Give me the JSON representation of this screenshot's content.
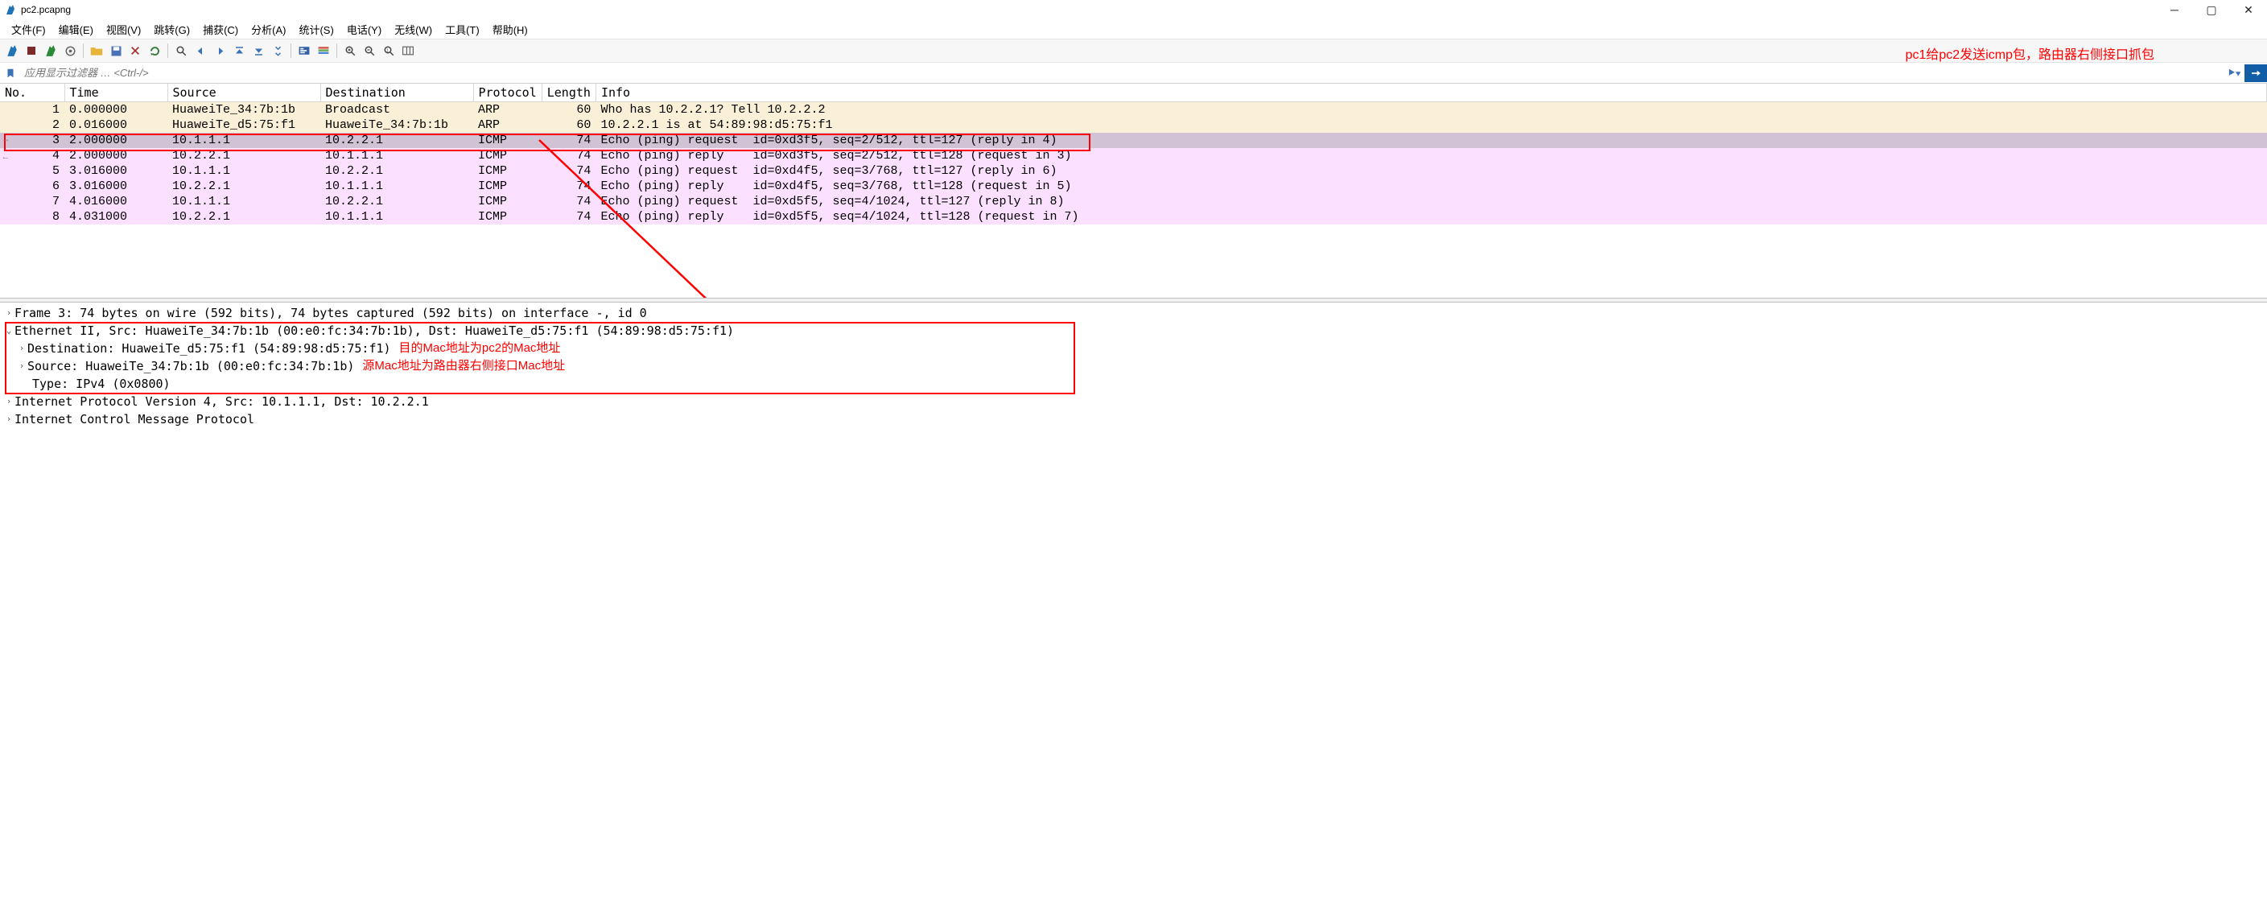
{
  "window": {
    "title": "pc2.pcapng"
  },
  "menu": {
    "items": [
      "文件(F)",
      "编辑(E)",
      "视图(V)",
      "跳转(G)",
      "捕获(C)",
      "分析(A)",
      "统计(S)",
      "电话(Y)",
      "无线(W)",
      "工具(T)",
      "帮助(H)"
    ]
  },
  "annotations": {
    "top": "pc1给pc2发送icmp包，路由器右侧接口抓包",
    "dst_mac": "目的Mac地址为pc2的Mac地址",
    "src_mac": "源Mac地址为路由器右侧接口Mac地址"
  },
  "filter": {
    "placeholder": "应用显示过滤器 … <Ctrl-/>"
  },
  "columns": {
    "no": "No.",
    "time": "Time",
    "source": "Source",
    "destination": "Destination",
    "protocol": "Protocol",
    "length": "Length",
    "info": "Info"
  },
  "packets": [
    {
      "no": "1",
      "time": "0.000000",
      "src": "HuaweiTe_34:7b:1b",
      "dst": "Broadcast",
      "proto": "ARP",
      "len": "60",
      "info": "Who has 10.2.2.1? Tell 10.2.2.2",
      "cls": "arp"
    },
    {
      "no": "2",
      "time": "0.016000",
      "src": "HuaweiTe_d5:75:f1",
      "dst": "HuaweiTe_34:7b:1b",
      "proto": "ARP",
      "len": "60",
      "info": "10.2.2.1 is at 54:89:98:d5:75:f1",
      "cls": "arp"
    },
    {
      "no": "3",
      "time": "2.000000",
      "src": "10.1.1.1",
      "dst": "10.2.2.1",
      "proto": "ICMP",
      "len": "74",
      "info": "Echo (ping) request  id=0xd3f5, seq=2/512, ttl=127 (reply in 4)",
      "cls": "icmp selected"
    },
    {
      "no": "4",
      "time": "2.000000",
      "src": "10.2.2.1",
      "dst": "10.1.1.1",
      "proto": "ICMP",
      "len": "74",
      "info": "Echo (ping) reply    id=0xd3f5, seq=2/512, ttl=128 (request in 3)",
      "cls": "icmp"
    },
    {
      "no": "5",
      "time": "3.016000",
      "src": "10.1.1.1",
      "dst": "10.2.2.1",
      "proto": "ICMP",
      "len": "74",
      "info": "Echo (ping) request  id=0xd4f5, seq=3/768, ttl=127 (reply in 6)",
      "cls": "icmp"
    },
    {
      "no": "6",
      "time": "3.016000",
      "src": "10.2.2.1",
      "dst": "10.1.1.1",
      "proto": "ICMP",
      "len": "74",
      "info": "Echo (ping) reply    id=0xd4f5, seq=3/768, ttl=128 (request in 5)",
      "cls": "icmp"
    },
    {
      "no": "7",
      "time": "4.016000",
      "src": "10.1.1.1",
      "dst": "10.2.2.1",
      "proto": "ICMP",
      "len": "74",
      "info": "Echo (ping) request  id=0xd5f5, seq=4/1024, ttl=127 (reply in 8)",
      "cls": "icmp"
    },
    {
      "no": "8",
      "time": "4.031000",
      "src": "10.2.2.1",
      "dst": "10.1.1.1",
      "proto": "ICMP",
      "len": "74",
      "info": "Echo (ping) reply    id=0xd5f5, seq=4/1024, ttl=128 (request in 7)",
      "cls": "icmp"
    }
  ],
  "details": {
    "frame": "Frame 3: 74 bytes on wire (592 bits), 74 bytes captured (592 bits) on interface -, id 0",
    "eth": "Ethernet II, Src: HuaweiTe_34:7b:1b (00:e0:fc:34:7b:1b), Dst: HuaweiTe_d5:75:f1 (54:89:98:d5:75:f1)",
    "eth_dst": "Destination: HuaweiTe_d5:75:f1 (54:89:98:d5:75:f1)",
    "eth_src": "Source: HuaweiTe_34:7b:1b (00:e0:fc:34:7b:1b)",
    "eth_type": "Type: IPv4 (0x0800)",
    "ip": "Internet Protocol Version 4, Src: 10.1.1.1, Dst: 10.2.2.1",
    "icmp": "Internet Control Message Protocol"
  }
}
